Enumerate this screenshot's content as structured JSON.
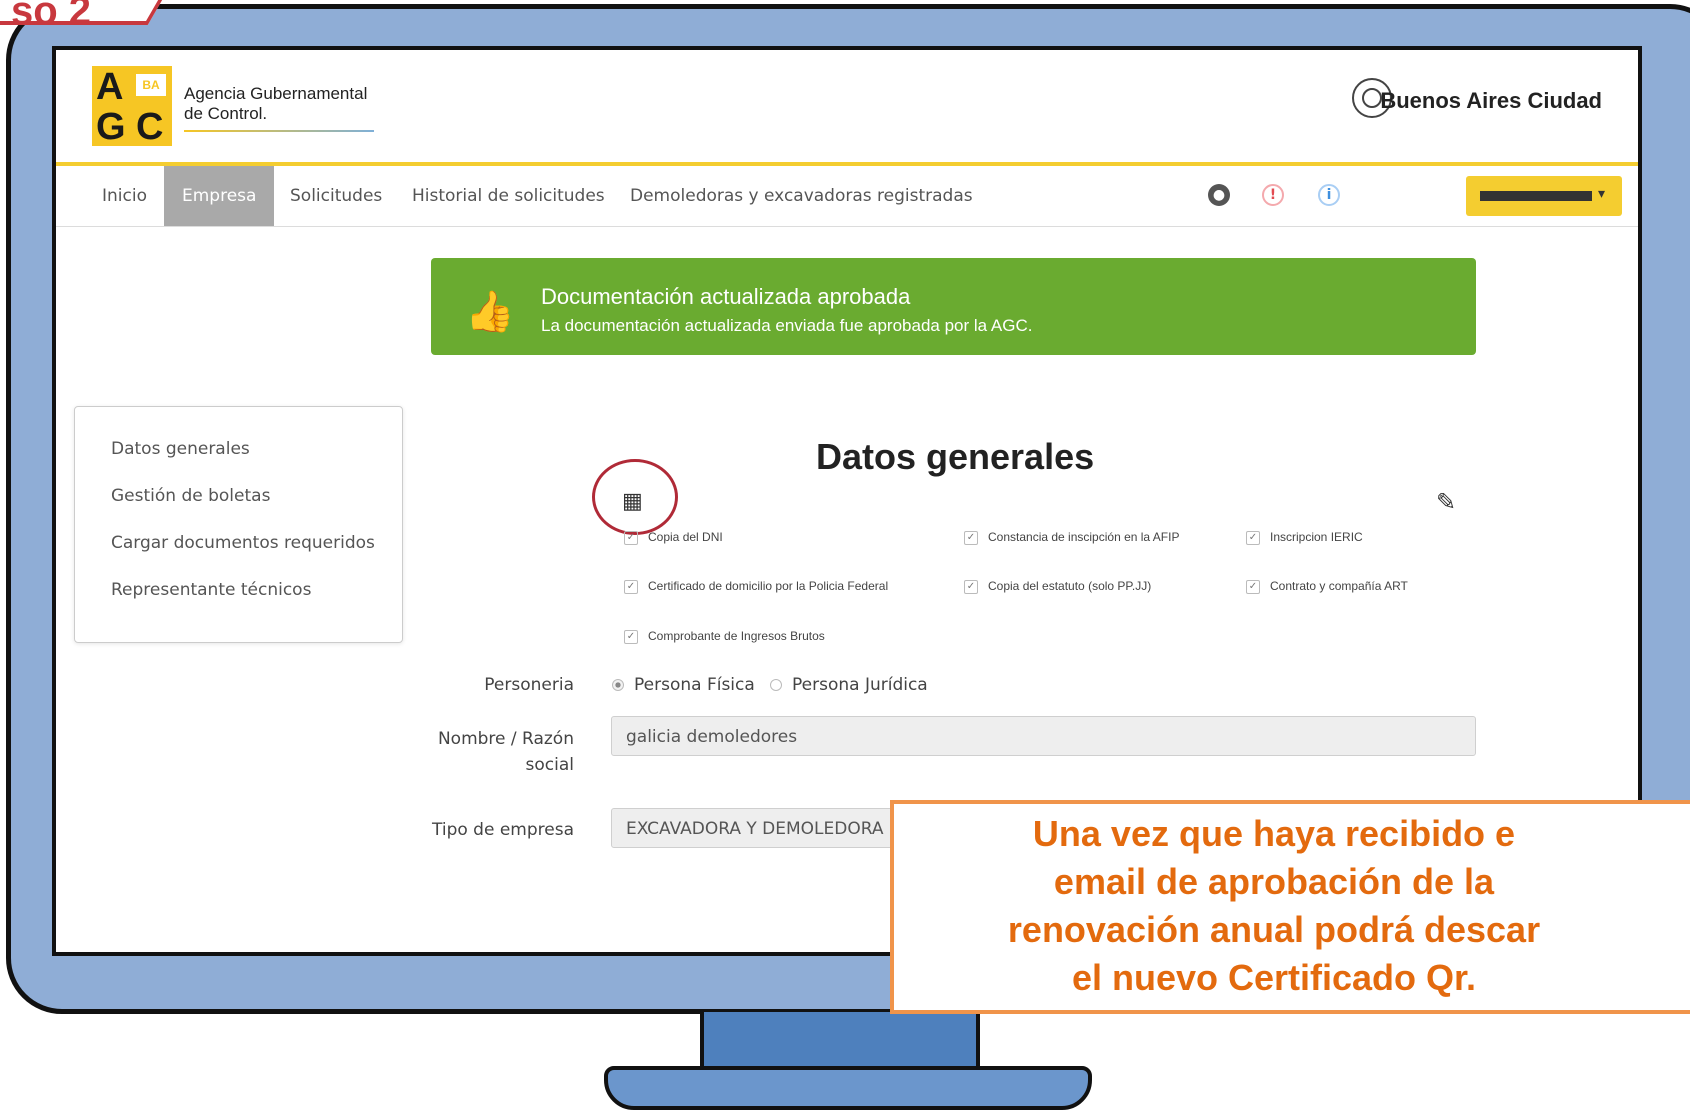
{
  "step": {
    "label": "so 2"
  },
  "header": {
    "agc_letters": [
      "A",
      "G",
      "C"
    ],
    "agc_ba": "BA",
    "agc_name_line1": "Agencia Gubernamental",
    "agc_name_line2": "de Control.",
    "city_name": "Buenos Aires Ciudad"
  },
  "nav": {
    "items": [
      "Inicio",
      "Empresa",
      "Solicitudes",
      "Historial de solicitudes",
      "Demoledoras y excavadoras registradas"
    ],
    "active": "Empresa",
    "icons": [
      "globe-icon",
      "alert-icon",
      "info-icon",
      "user-dropdown"
    ]
  },
  "alert": {
    "title": "Documentación actualizada aprobada",
    "body": "La documentación actualizada enviada fue aprobada por la AGC.",
    "color": "#6aab30"
  },
  "sidebar": {
    "items": [
      "Datos generales",
      "Gestión de boletas",
      "Cargar documentos requeridos",
      "Representante técnicos"
    ]
  },
  "main": {
    "title": "Datos generales",
    "documents": [
      "Copia del DNI",
      "Constancia de inscipción en la AFIP",
      "Inscripcion IERIC",
      "Certificado de domicilio por la Policia Federal",
      "Copia del estatuto (solo PP.JJ)",
      "Contrato y compañía ART",
      "Comprobante de Ingresos Brutos"
    ],
    "personeria_label": "Personeria",
    "personeria_options": [
      "Persona Física",
      "Persona Jurídica"
    ],
    "personeria_selected": "Persona Física",
    "nombre_label_line1": "Nombre / Razón",
    "nombre_label_line2": "social",
    "nombre_value": "galicia demoledores",
    "tipo_label": "Tipo de empresa",
    "tipo_value": "EXCAVADORA Y DEMOLEDORA"
  },
  "callout": {
    "line1": "Una vez que haya recibido e",
    "line2": "email de aprobación de la",
    "line3": "renovación anual podrá descar",
    "line4": "el nuevo Certificado Qr."
  },
  "colors": {
    "accent": "#f4cd30",
    "success": "#6aab30",
    "callout": "#e36a0e",
    "monitor": "#8fadd6"
  }
}
